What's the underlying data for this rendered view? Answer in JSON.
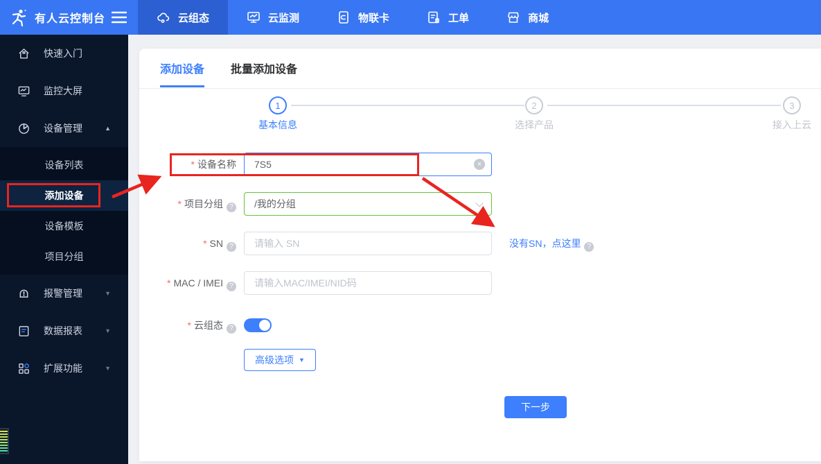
{
  "header": {
    "title": "有人云控制台",
    "nav": [
      {
        "label": "云组态"
      },
      {
        "label": "云监测"
      },
      {
        "label": "物联卡"
      },
      {
        "label": "工单"
      },
      {
        "label": "商城"
      }
    ]
  },
  "sidebar": {
    "items": [
      {
        "label": "快速入门"
      },
      {
        "label": "监控大屏"
      },
      {
        "label": "设备管理"
      },
      {
        "label": "报警管理"
      },
      {
        "label": "数据报表"
      },
      {
        "label": "扩展功能"
      }
    ],
    "submenu": [
      {
        "label": "设备列表"
      },
      {
        "label": "添加设备"
      },
      {
        "label": "设备模板"
      },
      {
        "label": "项目分组"
      }
    ]
  },
  "tabs": [
    {
      "label": "添加设备"
    },
    {
      "label": "批量添加设备"
    }
  ],
  "steps": [
    {
      "num": "1",
      "label": "基本信息"
    },
    {
      "num": "2",
      "label": "选择产品"
    },
    {
      "num": "3",
      "label": "接入上云"
    }
  ],
  "form": {
    "required_mark": "*",
    "device_name": {
      "label": "设备名称",
      "value": "7S5"
    },
    "project_group": {
      "label": "项目分组",
      "value": "/我的分组"
    },
    "sn": {
      "label": "SN",
      "placeholder": "请输入 SN",
      "no_sn_link": "没有SN，点这里"
    },
    "mac_imei": {
      "label": "MAC / IMEI",
      "placeholder": "请输入MAC/IMEI/NID码"
    },
    "cloud_scada": {
      "label": "云组态",
      "state": "on"
    },
    "advanced_button": "高级选项",
    "next_button": "下一步"
  },
  "icons": {
    "help": "?",
    "clear": "×",
    "caret_up": "▲",
    "caret_down": "▼"
  },
  "colors": {
    "header_blue": "#3876f3",
    "active_tab_blue": "#2c5fd1",
    "accent_blue": "#3d7ffc",
    "sidebar_navy": "#0a1629",
    "success_green": "#67c23a",
    "annotation_red": "#e8251f",
    "main_bg": "#eef0f4"
  }
}
